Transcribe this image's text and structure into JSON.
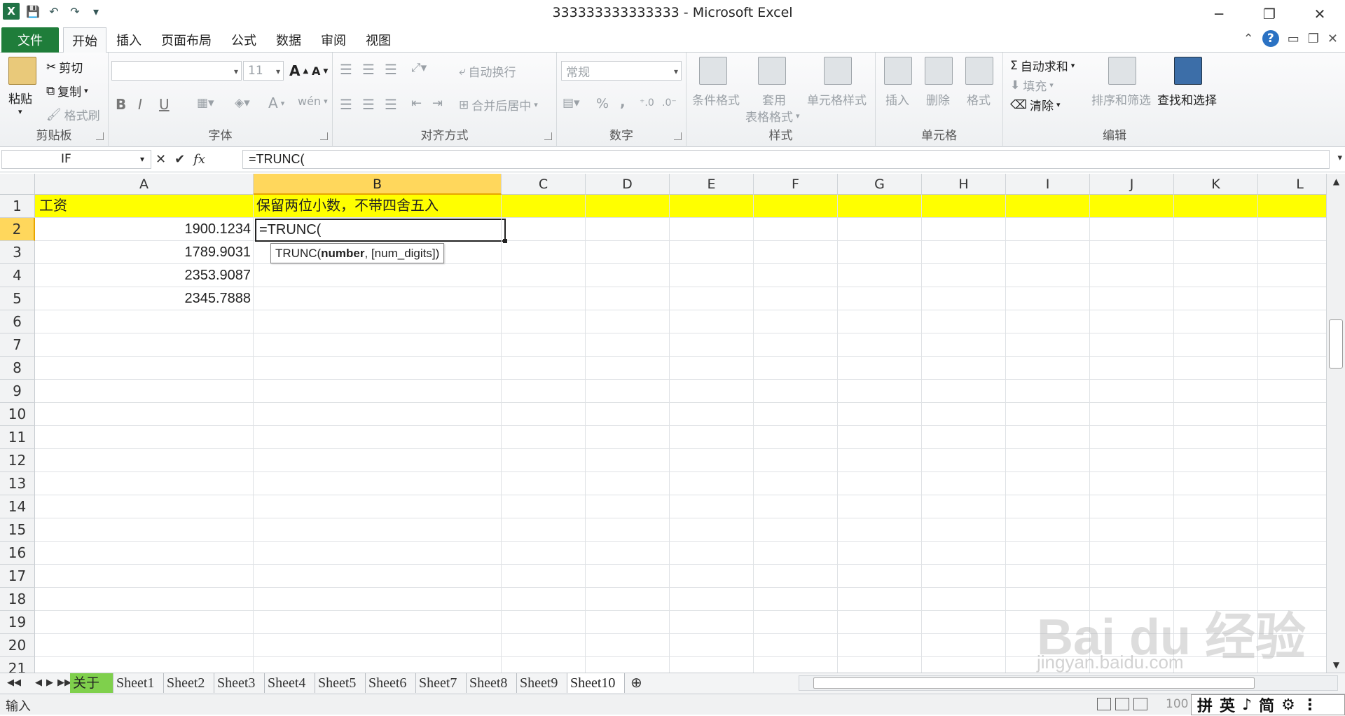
{
  "window": {
    "title": "333333333333333 - Microsoft Excel",
    "app_icon": "X",
    "controls": [
      "─",
      "❐",
      "✕"
    ]
  },
  "quick_access": {
    "save": "💾",
    "undo": "↶",
    "redo": "↷",
    "more": "▾"
  },
  "tabs": {
    "file": "文件",
    "items": [
      "开始",
      "插入",
      "页面布局",
      "公式",
      "数据",
      "审阅",
      "视图"
    ],
    "active": "开始"
  },
  "ribbon": {
    "clipboard": {
      "label": "剪贴板",
      "paste": "粘贴",
      "cut": "剪切",
      "copy": "复制",
      "format_painter": "格式刷"
    },
    "font": {
      "label": "字体",
      "font_name": "",
      "font_size": "11",
      "bold": "B",
      "italic": "I",
      "underline": "U",
      "grow": "A",
      "shrink": "A",
      "font_color": "A",
      "wen": "wén"
    },
    "alignment": {
      "label": "对齐方式",
      "wrap_text": "自动换行",
      "merge_center": "合并后居中"
    },
    "number": {
      "label": "数字",
      "format": "常规",
      "percent": "%",
      "comma": ","
    },
    "styles": {
      "label": "样式",
      "conditional": "条件格式",
      "table_format_1": "套用",
      "table_format_2": "表格格式",
      "cell_styles": "单元格样式"
    },
    "cells": {
      "label": "单元格",
      "insert": "插入",
      "delete": "删除",
      "format": "格式"
    },
    "editing": {
      "label": "编辑",
      "autosum": "自动求和",
      "fill": "填充",
      "clear": "清除",
      "sort_filter": "排序和筛选",
      "find_select": "查找和选择"
    }
  },
  "formula_bar": {
    "name_box": "IF",
    "cancel": "✕",
    "enter": "✔",
    "fx": "fx",
    "formula": "=TRUNC("
  },
  "sheet": {
    "columns": [
      "A",
      "B",
      "C",
      "D",
      "E",
      "F",
      "G",
      "H",
      "I",
      "J",
      "K",
      "L"
    ],
    "rows": [
      "1",
      "2",
      "3",
      "4",
      "5",
      "6",
      "7",
      "8",
      "9",
      "10",
      "11",
      "12",
      "13",
      "14",
      "15",
      "16",
      "17",
      "18",
      "19",
      "20",
      "21"
    ],
    "selected_column": "B",
    "selected_row": "2",
    "cells": {
      "A1": "工资",
      "B1": "保留两位小数，不带四舍五入",
      "A2": "1900.1234",
      "A3": "1789.9031",
      "A4": "2353.9087",
      "A5": "2345.7888",
      "B2": "=TRUNC("
    },
    "tooltip": {
      "func": "TRUNC(",
      "arg1": "number",
      "rest": ", [num_digits])"
    },
    "highlight_color": "#ffff00"
  },
  "sheet_tabs": {
    "items": [
      "关于",
      "Sheet1",
      "Sheet2",
      "Sheet3",
      "Sheet4",
      "Sheet5",
      "Sheet6",
      "Sheet7",
      "Sheet8",
      "Sheet9",
      "Sheet10"
    ],
    "active": "Sheet10",
    "green_tab": "关于"
  },
  "status_bar": {
    "mode": "输入",
    "zoom": "100",
    "ime": [
      "拼",
      "英",
      "♪",
      "简",
      "⚙",
      "⋮"
    ]
  },
  "watermark": {
    "text": "Bai du 经验",
    "url": "jingyan.baidu.com"
  }
}
